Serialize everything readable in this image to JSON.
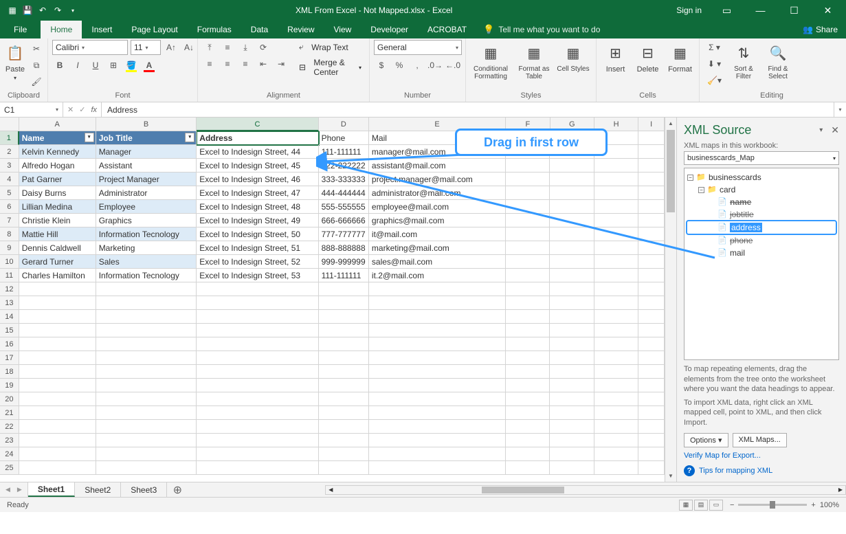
{
  "titlebar": {
    "title": "XML From Excel - Not Mapped.xlsx - Excel",
    "signin": "Sign in"
  },
  "tabs": {
    "file": "File",
    "home": "Home",
    "insert": "Insert",
    "page_layout": "Page Layout",
    "formulas": "Formulas",
    "data": "Data",
    "review": "Review",
    "view": "View",
    "developer": "Developer",
    "acrobat": "ACROBAT",
    "tellme": "Tell me what you want to do",
    "share": "Share"
  },
  "ribbon": {
    "clipboard": "Clipboard",
    "paste": "Paste",
    "font_group": "Font",
    "font_name": "Calibri",
    "font_size": "11",
    "alignment": "Alignment",
    "wrap": "Wrap Text",
    "merge": "Merge & Center",
    "number": "Number",
    "numfmt": "General",
    "styles": "Styles",
    "cf": "Conditional Formatting",
    "fat": "Format as Table",
    "cs": "Cell Styles",
    "cells": "Cells",
    "insert": "Insert",
    "delete": "Delete",
    "format": "Format",
    "editing": "Editing",
    "sort": "Sort & Filter",
    "find": "Find & Select"
  },
  "formula_bar": {
    "cell_ref": "C1",
    "value": "Address"
  },
  "columns": [
    "A",
    "B",
    "C",
    "D",
    "E",
    "F",
    "G",
    "H",
    "I"
  ],
  "headers": {
    "name": "Name",
    "job": "Job Title",
    "address": "Address",
    "phone": "Phone",
    "mail": "Mail"
  },
  "table": [
    {
      "name": "Kelvin Kennedy",
      "job": "Manager",
      "addr": "Excel to Indesign Street, 44",
      "phone": "111-111111",
      "mail": "manager@mail.com"
    },
    {
      "name": "Alfredo Hogan",
      "job": "Assistant",
      "addr": "Excel to Indesign Street, 45",
      "phone": "222-222222",
      "mail": "assistant@mail.com"
    },
    {
      "name": "Pat Garner",
      "job": "Project Manager",
      "addr": "Excel to Indesign Street, 46",
      "phone": "333-333333",
      "mail": "project.manager@mail.com"
    },
    {
      "name": "Daisy Burns",
      "job": "Administrator",
      "addr": "Excel to Indesign Street, 47",
      "phone": "444-444444",
      "mail": "administrator@mail.com"
    },
    {
      "name": "Lillian Medina",
      "job": "Employee",
      "addr": "Excel to Indesign Street, 48",
      "phone": "555-555555",
      "mail": "employee@mail.com"
    },
    {
      "name": "Christie Klein",
      "job": "Graphics",
      "addr": "Excel to Indesign Street, 49",
      "phone": "666-666666",
      "mail": "graphics@mail.com"
    },
    {
      "name": "Mattie Hill",
      "job": "Information Tecnology",
      "addr": "Excel to Indesign Street, 50",
      "phone": "777-777777",
      "mail": "it@mail.com"
    },
    {
      "name": "Dennis Caldwell",
      "job": "Marketing",
      "addr": "Excel to Indesign Street, 51",
      "phone": "888-888888",
      "mail": "marketing@mail.com"
    },
    {
      "name": "Gerard Turner",
      "job": "Sales",
      "addr": "Excel to Indesign Street, 52",
      "phone": "999-999999",
      "mail": "sales@mail.com"
    },
    {
      "name": "Charles Hamilton",
      "job": "Information Tecnology",
      "addr": "Excel to Indesign Street, 53",
      "phone": "111-111111",
      "mail": "it.2@mail.com"
    }
  ],
  "xml": {
    "title": "XML Source",
    "maps_label": "XML maps in this workbook:",
    "map_name": "businesscards_Map",
    "root": "businesscards",
    "card": "card",
    "fields": {
      "name": "name",
      "jobtitle": "jobtitle",
      "address": "address",
      "phone": "phone",
      "mail": "mail"
    },
    "help1": "To map repeating elements, drag the elements from the tree onto the worksheet where you want the data headings to appear.",
    "help2": "To import XML data, right click an XML mapped cell, point to XML, and then click Import.",
    "options": "Options",
    "xmlmaps": "XML Maps...",
    "verify": "Verify Map for Export...",
    "tips": "Tips for mapping XML"
  },
  "sheets": {
    "s1": "Sheet1",
    "s2": "Sheet2",
    "s3": "Sheet3"
  },
  "status": {
    "ready": "Ready",
    "zoom": "100%"
  },
  "callout": "Drag in first row"
}
